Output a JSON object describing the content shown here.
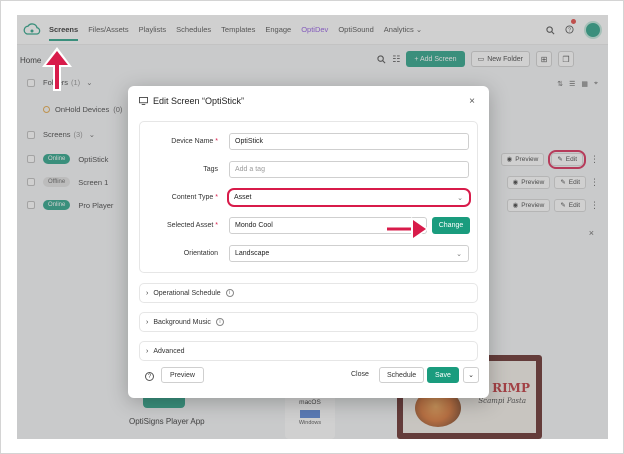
{
  "nav": {
    "items": [
      {
        "label": "Screens",
        "active": true
      },
      {
        "label": "Files/Assets"
      },
      {
        "label": "Playlists"
      },
      {
        "label": "Schedules"
      },
      {
        "label": "Templates"
      },
      {
        "label": "Engage"
      },
      {
        "label": "OptiDev",
        "accent": "#8a4de0"
      },
      {
        "label": "OptiSound"
      },
      {
        "label": "Analytics ⌄"
      }
    ],
    "icons": [
      "search-icon",
      "help-icon",
      "avatar"
    ]
  },
  "subbar": {
    "title": "Home",
    "add_screen": "+ Add Screen",
    "new_folder": "New Folder"
  },
  "folders": {
    "label": "Folders",
    "count": "(1)",
    "item": "OnHold Devices",
    "item_count": "(0)"
  },
  "screens": {
    "label": "Screens",
    "count": "(3)"
  },
  "rows": [
    {
      "status": "Online",
      "name": "OptiStick",
      "preview": "Preview",
      "edit": "Edit"
    },
    {
      "status": "Offline",
      "name": "Screen 1",
      "preview": "Preview",
      "edit": "Edit"
    },
    {
      "status": "Online",
      "name": "Pro Player",
      "preview": "Preview",
      "edit": "Edit"
    }
  ],
  "background": {
    "player_app": "OptiSigns Player App",
    "macos": "macOS",
    "windows": "Windows",
    "promo_title": "RIMP",
    "promo_sub": "Scampi Pasta"
  },
  "modal": {
    "title": "Edit Screen “OptiStick”",
    "fields": {
      "device_name_label": "Device Name",
      "device_name_value": "OptiStick",
      "tags_label": "Tags",
      "tags_placeholder": "Add a tag",
      "content_type_label": "Content Type",
      "content_type_value": "Asset",
      "selected_asset_label": "Selected Asset",
      "selected_asset_value": "Mondo Cool",
      "change_label": "Change",
      "orientation_label": "Orientation",
      "orientation_value": "Landscape"
    },
    "sections": [
      "Operational Schedule",
      "Background Music",
      "Advanced"
    ],
    "footer": {
      "preview": "Preview",
      "close": "Close",
      "schedule": "Schedule",
      "save": "Save"
    }
  },
  "colors": {
    "brand": "#1a9c7e",
    "highlight": "#d81b4a",
    "accent": "#8a4de0"
  }
}
